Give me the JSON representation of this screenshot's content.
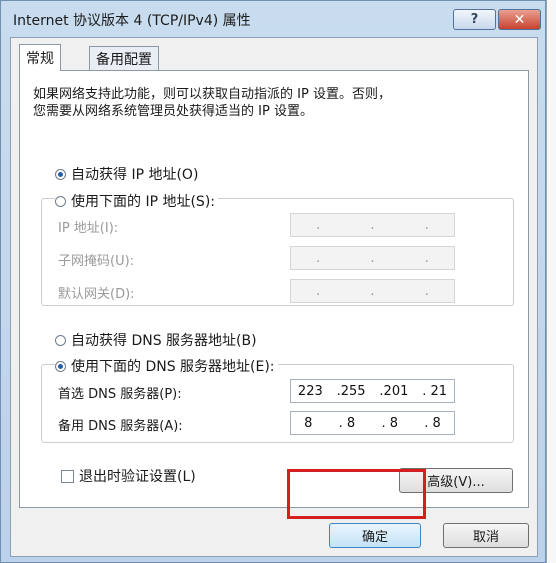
{
  "window": {
    "title": "Internet 协议版本 4 (TCP/IPv4) 属性",
    "help_glyph": "?",
    "close_glyph": "✕"
  },
  "tabs": [
    {
      "label": "常规",
      "active": true
    },
    {
      "label": "备用配置",
      "active": false
    }
  ],
  "description": [
    "如果网络支持此功能，则可以获取自动指派的 IP 设置。否则，",
    "您需要从网络系统管理员处获得适当的 IP 设置。"
  ],
  "ip_section": {
    "auto_label": "自动获得 IP 地址(O)",
    "auto_selected": true,
    "manual_label": "使用下面的 IP 地址(S):",
    "manual_selected": false,
    "fields": [
      {
        "label": "IP 地址(I):",
        "value": [
          ".",
          ".",
          "."
        ]
      },
      {
        "label": "子网掩码(U):",
        "value": [
          ".",
          ".",
          "."
        ]
      },
      {
        "label": "默认网关(D):",
        "value": [
          ".",
          ".",
          "."
        ]
      }
    ]
  },
  "dns_section": {
    "auto_label": "自动获得 DNS 服务器地址(B)",
    "auto_selected": false,
    "manual_label": "使用下面的 DNS 服务器地址(E):",
    "manual_selected": true,
    "fields": [
      {
        "label": "首选 DNS 服务器(P):",
        "value": [
          "223",
          ".255",
          ".201",
          ". 21"
        ]
      },
      {
        "label": "备用 DNS 服务器(A):",
        "value": [
          "8",
          ". 8",
          ". 8",
          ". 8"
        ]
      }
    ]
  },
  "validate_label": "退出时验证设置(L)",
  "advanced_label": "高级(V)...",
  "ok_label": "确定",
  "cancel_label": "取消",
  "colors": {
    "highlight": "#d51f1f",
    "titlebar": "#bcd3ea"
  }
}
